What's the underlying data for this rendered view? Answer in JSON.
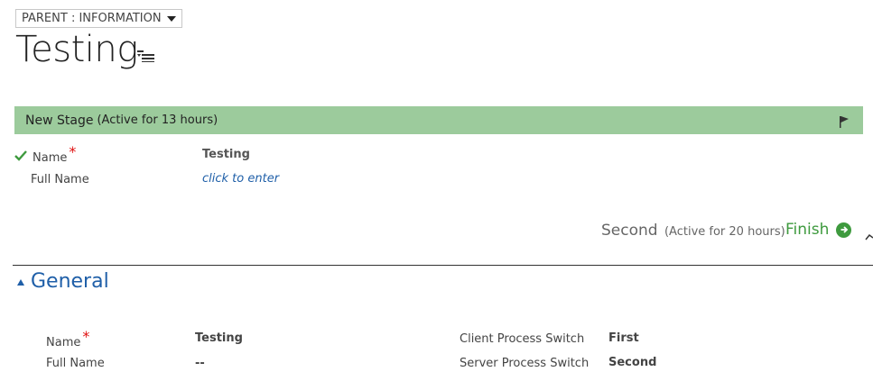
{
  "form_selector": {
    "label": "PARENT : INFORMATION"
  },
  "record": {
    "title": "Testing"
  },
  "stage_bar": {
    "stage_name": "New Stage",
    "active_note": "(Active for 13 hours)",
    "color": "#9ccb9c"
  },
  "stage_fields": [
    {
      "label": "Name",
      "required": "*",
      "value": "Testing"
    },
    {
      "label": "Full Name",
      "value": "click to enter"
    }
  ],
  "process": {
    "next_stage": "Second",
    "next_active_note": "(Active for 20 hours)",
    "finish_label": "Finish"
  },
  "section": {
    "title": "General",
    "fields_left": [
      {
        "label": "Name",
        "required": "*",
        "value": "Testing"
      },
      {
        "label": "Full Name",
        "value": "--"
      }
    ],
    "fields_right": [
      {
        "label": "Client Process Switch",
        "value": "First"
      },
      {
        "label": "Server Process Switch",
        "value": "Second"
      }
    ]
  },
  "colors": {
    "accent": "#1f5fa8",
    "success": "#3e9a3e",
    "required": "#e01010"
  }
}
